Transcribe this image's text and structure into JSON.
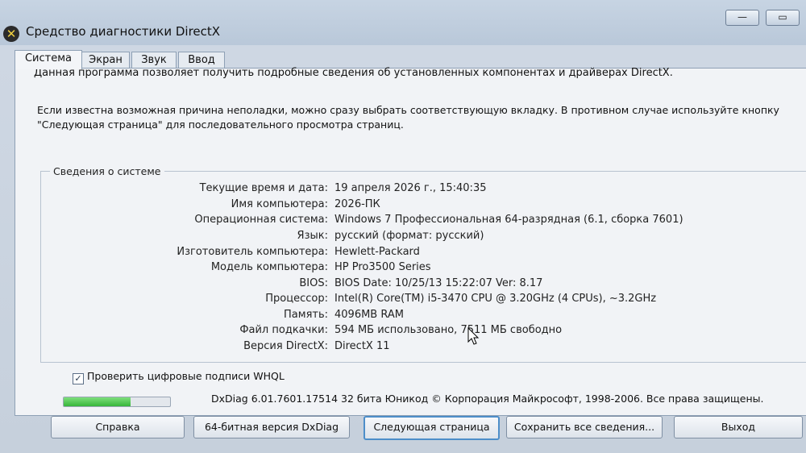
{
  "window": {
    "title": "Средство диагностики DirectX",
    "minimize_glyph": "—",
    "maximize_glyph": "▭"
  },
  "tabs": [
    {
      "label": "Система",
      "active": true
    },
    {
      "label": "Экран",
      "active": false
    },
    {
      "label": "Звук",
      "active": false
    },
    {
      "label": "Ввод",
      "active": false
    }
  ],
  "intro_text": "Данная программа позволяет получить подробные сведения об установленных компонентах и драйверах DirectX.",
  "hint_text": "Если известна возможная причина неполадки, можно сразу выбрать соответствующую вкладку. В противном случае используйте кнопку \"Следующая страница\" для последовательного просмотра страниц.",
  "system_info": {
    "group_title": "Сведения о системе",
    "rows": [
      {
        "label": "Текущие время и дата:",
        "value": "19 апреля 2026 г., 15:40:35"
      },
      {
        "label": "Имя компьютера:",
        "value": "2026-ПК"
      },
      {
        "label": "Операционная система:",
        "value": "Windows 7 Профессиональная 64-разрядная (6.1, сборка 7601)"
      },
      {
        "label": "Язык:",
        "value": "русский (формат: русский)"
      },
      {
        "label": "Изготовитель компьютера:",
        "value": "Hewlett-Packard"
      },
      {
        "label": "Модель компьютера:",
        "value": "HP Pro3500 Series"
      },
      {
        "label": "BIOS:",
        "value": "BIOS Date: 10/25/13 15:22:07 Ver: 8.17"
      },
      {
        "label": "Процессор:",
        "value": "Intel(R) Core(TM) i5-3470 CPU @ 3.20GHz (4 CPUs), ~3.2GHz"
      },
      {
        "label": "Память:",
        "value": "4096MB RAM"
      },
      {
        "label": "Файл подкачки:",
        "value": "594 МБ использовано, 7511 МБ свободно"
      },
      {
        "label": "Версия DirectX:",
        "value": "DirectX 11"
      }
    ]
  },
  "whql_checkbox": {
    "label": "Проверить цифровые подписи WHQL",
    "checked": true
  },
  "progress": {
    "fraction": 0.63,
    "color": "#37b53a"
  },
  "footer_text": "DxDiag 6.01.7601.17514 32 бита Юникод  © Корпорация Майкрософт, 1998-2006.  Все права защищены.",
  "buttons": {
    "help": "Справка",
    "dxdiag64": "64-битная версия DxDiag",
    "next_page": "Следующая страница",
    "save_all": "Сохранить все сведения...",
    "exit": "Выход"
  }
}
